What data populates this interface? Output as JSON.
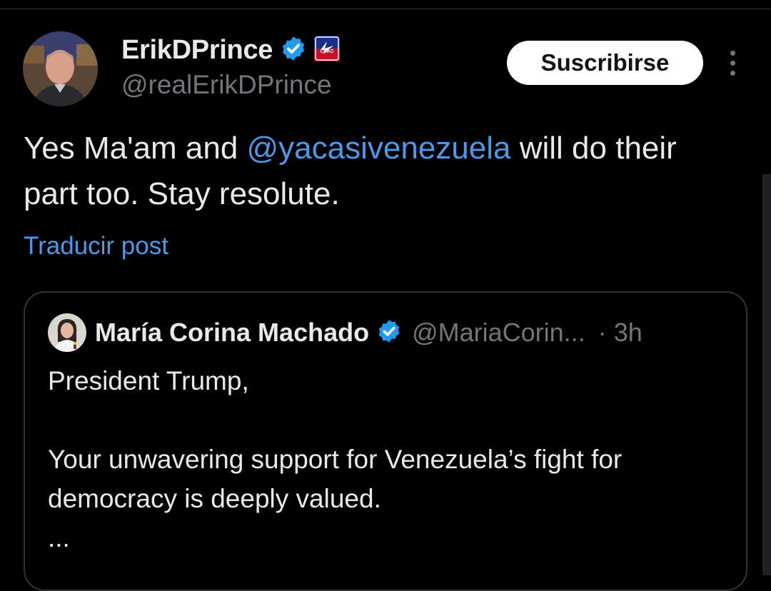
{
  "post": {
    "author": {
      "display_name": "ErikDPrince",
      "handle": "@realErikDPrince",
      "avatar_icon": "profile-photo",
      "verified_icon": "verified-badge-icon",
      "affiliate_badge_icon": "cpac-badge-icon"
    },
    "subscribe_label": "Suscribirse",
    "more_icon": "more-options-icon",
    "text_before": "Yes Ma'am and ",
    "mention": "@yacasivenezuela",
    "text_after": " will do their part too. Stay resolute.",
    "translate_label": "Traducir post"
  },
  "quoted_post": {
    "display_name": "María Corina Machado",
    "handle": "@MariaCorin...",
    "separator": "·",
    "time": "3h",
    "line1": "President Trump,",
    "line2": "Your unwavering support for Venezuela’s fight for democracy is deeply valued.",
    "ellipsis": "..."
  },
  "colors": {
    "background": "#000000",
    "text": "#e7e9ea",
    "muted": "#71767b",
    "link": "#4a99e9",
    "verified": "#1d9bf0",
    "border": "#2f3336"
  }
}
